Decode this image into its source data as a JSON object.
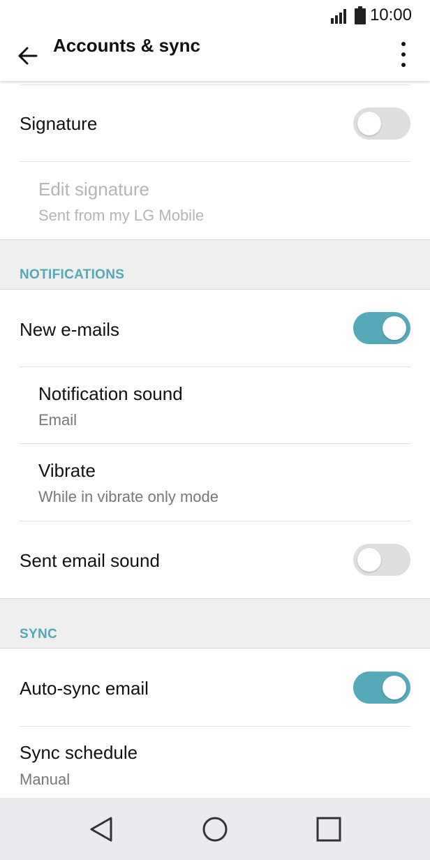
{
  "status_bar": {
    "time": "10:00"
  },
  "app_bar": {
    "title": "Accounts & sync"
  },
  "settings": {
    "signature": {
      "label": "Signature",
      "enabled": false
    },
    "edit_signature": {
      "label": "Edit signature",
      "value": "Sent from my LG Mobile"
    },
    "notifications_header": "NOTIFICATIONS",
    "new_emails": {
      "label": "New e-mails",
      "enabled": true
    },
    "notification_sound": {
      "label": "Notification sound",
      "value": "Email"
    },
    "vibrate": {
      "label": "Vibrate",
      "value": "While in vibrate only mode"
    },
    "sent_email_sound": {
      "label": "Sent email sound",
      "enabled": false
    },
    "sync_header": "SYNC",
    "auto_sync_email": {
      "label": "Auto-sync email",
      "enabled": true
    },
    "sync_schedule": {
      "label": "Sync schedule",
      "value": "Manual"
    }
  },
  "colors": {
    "accent": "#55a9b8",
    "section_title": "#53a8b8",
    "toggle_off": "#dedede"
  },
  "icons": {
    "back": "arrow-left-icon",
    "more": "more-vert-icon",
    "signal": "signal-icon",
    "battery": "battery-icon",
    "nav_back": "triangle-back-icon",
    "nav_home": "circle-home-icon",
    "nav_recent": "square-recent-icon"
  }
}
